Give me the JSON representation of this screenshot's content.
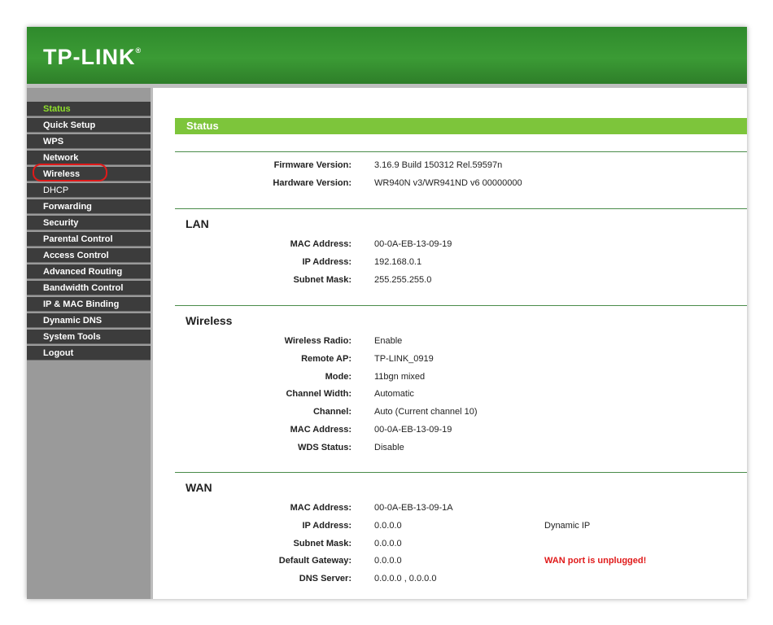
{
  "header": {
    "logo": "TP-LINK",
    "logo_mark": "®"
  },
  "sidebar": {
    "items": [
      {
        "label": "Status",
        "active": true
      },
      {
        "label": "Quick Setup"
      },
      {
        "label": "WPS"
      },
      {
        "label": "Network"
      },
      {
        "label": "Wireless",
        "highlighted": true
      },
      {
        "label": "DHCP"
      },
      {
        "label": "Forwarding"
      },
      {
        "label": "Security"
      },
      {
        "label": "Parental Control"
      },
      {
        "label": "Access Control"
      },
      {
        "label": "Advanced Routing"
      },
      {
        "label": "Bandwidth Control"
      },
      {
        "label": "IP & MAC Binding"
      },
      {
        "label": "Dynamic DNS"
      },
      {
        "label": "System Tools"
      },
      {
        "label": "Logout"
      }
    ]
  },
  "status": {
    "title": "Status",
    "firmware_label": "Firmware Version:",
    "firmware_value": "3.16.9 Build 150312 Rel.59597n",
    "hardware_label": "Hardware Version:",
    "hardware_value": "WR940N v3/WR941ND v6 00000000"
  },
  "lan": {
    "title": "LAN",
    "mac_label": "MAC Address:",
    "mac_value": "00-0A-EB-13-09-19",
    "ip_label": "IP Address:",
    "ip_value": "192.168.0.1",
    "mask_label": "Subnet Mask:",
    "mask_value": "255.255.255.0"
  },
  "wireless": {
    "title": "Wireless",
    "radio_label": "Wireless Radio:",
    "radio_value": "Enable",
    "remote_label": "Remote AP:",
    "remote_value": "TP-LINK_0919",
    "mode_label": "Mode:",
    "mode_value": "11bgn mixed",
    "width_label": "Channel Width:",
    "width_value": "Automatic",
    "channel_label": "Channel:",
    "channel_value": "Auto (Current channel 10)",
    "mac_label": "MAC Address:",
    "mac_value": "00-0A-EB-13-09-19",
    "wds_label": "WDS Status:",
    "wds_value": "Disable"
  },
  "wan": {
    "title": "WAN",
    "mac_label": "MAC Address:",
    "mac_value": "00-0A-EB-13-09-1A",
    "ip_label": "IP Address:",
    "ip_value": "0.0.0.0",
    "ip_extra": "Dynamic IP",
    "mask_label": "Subnet Mask:",
    "mask_value": "0.0.0.0",
    "gateway_label": "Default Gateway:",
    "gateway_value": "0.0.0.0",
    "gateway_extra": "WAN port is unplugged!",
    "dns_label": "DNS Server:",
    "dns_value": "0.0.0.0 , 0.0.0.0"
  },
  "colors": {
    "brand_green": "#3b9b35",
    "status_bar": "#7dc53b",
    "menu_bg": "#3c3c3c",
    "active_text": "#8fe02c",
    "warning": "#e01a1a"
  }
}
